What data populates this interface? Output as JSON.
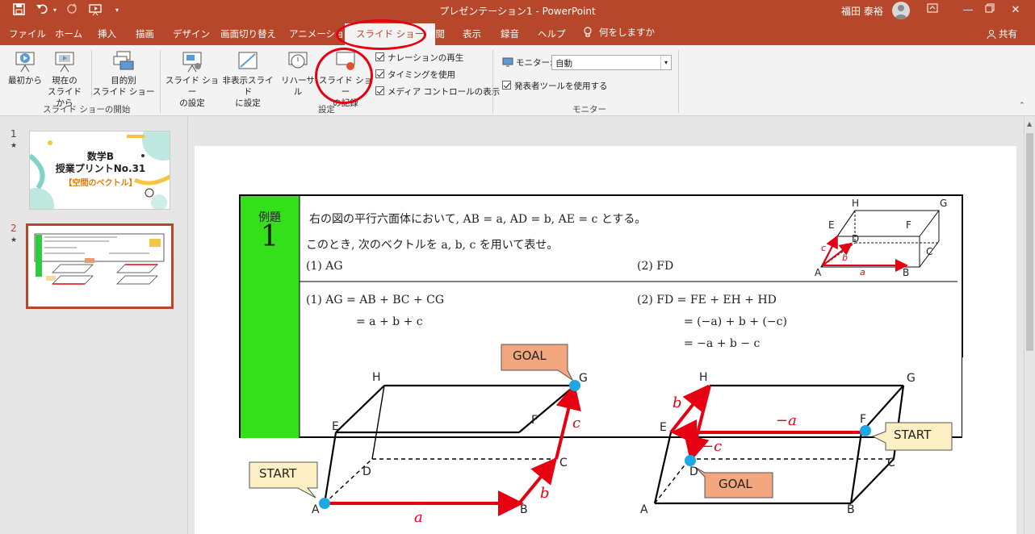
{
  "app": {
    "title": "プレゼンテーション1 - PowerPoint",
    "user": "福田 泰裕",
    "accent": "#b7472a",
    "highlight": "#e60012"
  },
  "quick_access": {
    "icons": [
      "save-icon",
      "undo-icon",
      "redo-icon",
      "start-from-beginning-icon",
      "customize-icon"
    ]
  },
  "tabs": [
    "ファイル",
    "ホーム",
    "挿入",
    "描画",
    "デザイン",
    "画面切り替え",
    "アニメーション",
    "スライド ショー",
    "校閲",
    "表示",
    "録音",
    "ヘルプ"
  ],
  "active_tab": "スライド ショー",
  "tell_me": "何をしますか",
  "share": "共有",
  "ribbon": {
    "group_start": {
      "label": "スライド ショーの開始",
      "from_beginning": "最初から",
      "from_current_1": "現在の",
      "from_current_2": "スライドから",
      "custom_1": "目的別",
      "custom_2": "スライド ショー"
    },
    "group_setup": {
      "label": "設定",
      "setup_1": "スライド ショー",
      "setup_2": "の設定",
      "hide_1": "非表示スライド",
      "hide_2": "に設定",
      "rehearse": "リハーサル",
      "record_1": "スライド ショー",
      "record_2": "の記録",
      "check_narration": "ナレーションの再生",
      "check_timing": "タイミングを使用",
      "check_media": "メディア コントロールの表示"
    },
    "group_monitor": {
      "label": "モニター",
      "monitor_label": "モニター:",
      "monitor_value": "自動",
      "presenter_view": "発表者ツールを使用する"
    }
  },
  "slides_panel": {
    "slide1_num": "1",
    "slide2_num": "2",
    "star": "★",
    "thumb1_title1": "数学B",
    "thumb1_title2": "授業プリントNo.31",
    "thumb1_title3": "【空間のベクトル】"
  },
  "slide": {
    "example_word": "例題",
    "example_num": "1",
    "problem_line1": "右の図の平行六面体において, AB = a, AD = b, AE = c とする。",
    "problem_line2": "このとき, 次のベクトルを a, b, c を用いて表せ。",
    "q1": "(1)  AG",
    "q2": "(2)  FD",
    "a1_line1": "(1)  AG = AB + BC + CG",
    "a1_line2": "= a + b + c",
    "a2_line1": "(2)  FD = FE + EH + HD",
    "a2_line2": "= (−a) + b + (−c)",
    "a2_line3": "= −a + b − c",
    "small_labels": [
      "H",
      "G",
      "E",
      "F",
      "D",
      "C",
      "A",
      "B"
    ],
    "fig_a_label": "a",
    "fig_b_label": "b",
    "fig_c_label": "c",
    "left": {
      "goal": "GOAL",
      "start": "START",
      "H": "H",
      "G": "G",
      "E": "E",
      "F": "F",
      "D": "D",
      "C": "C",
      "A": "A",
      "B": "B",
      "vec_a": "a",
      "vec_b": "b",
      "vec_c": "c"
    },
    "right": {
      "goal": "GOAL",
      "start": "START",
      "H": "H",
      "G": "G",
      "E": "E",
      "F": "F",
      "D": "D",
      "C": "C",
      "A": "A",
      "B": "B",
      "vec_neg_a": "−a",
      "vec_b": "b",
      "vec_neg_c": "−c"
    }
  }
}
